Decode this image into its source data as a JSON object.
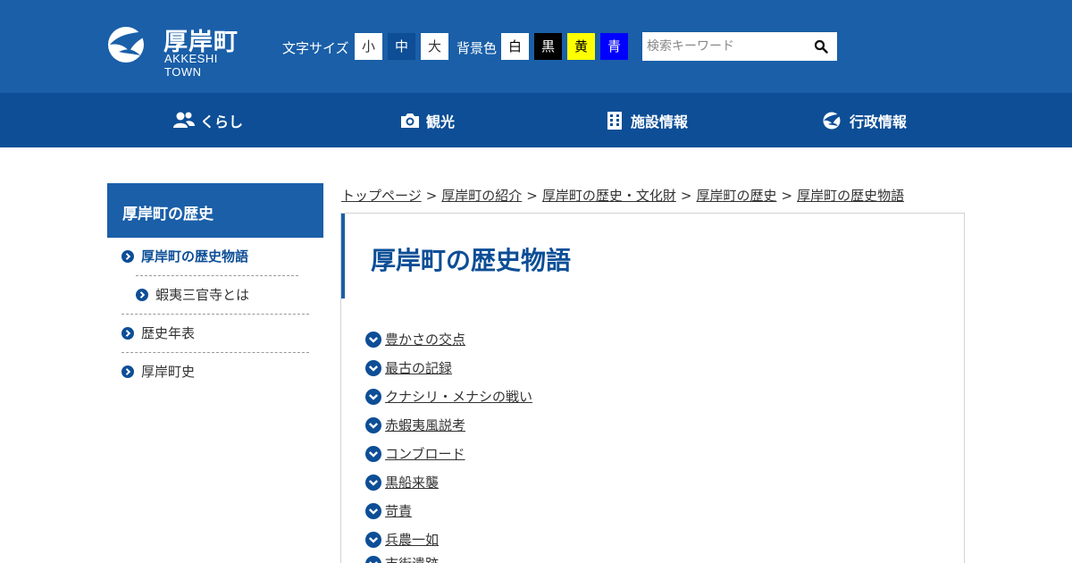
{
  "header": {
    "logo_jp": "厚岸町",
    "logo_en": "AKKESHI TOWN",
    "font_size_label": "文字サイズ",
    "font_sizes": [
      "小",
      "中",
      "大"
    ],
    "bg_color_label": "背景色",
    "bg_colors": [
      {
        "label": "白",
        "bg": "#ffffff",
        "fg": "#000000"
      },
      {
        "label": "黒",
        "bg": "#000000",
        "fg": "#ffffff"
      },
      {
        "label": "黄",
        "bg": "#ffff00",
        "fg": "#000000"
      },
      {
        "label": "青",
        "bg": "#0000ff",
        "fg": "#ffffff"
      }
    ],
    "search_placeholder": "検索キーワード"
  },
  "nav": [
    {
      "label": "くらし",
      "icon": "people-icon"
    },
    {
      "label": "観光",
      "icon": "camera-icon"
    },
    {
      "label": "施設情報",
      "icon": "building-icon"
    },
    {
      "label": "行政情報",
      "icon": "town-logo-icon"
    }
  ],
  "sidebar": {
    "heading": "厚岸町の歴史",
    "items": [
      {
        "label": "厚岸町の歴史物語",
        "active": true
      },
      {
        "label": "蝦夷三官寺とは",
        "active": false
      },
      {
        "label": "歴史年表",
        "active": false
      },
      {
        "label": "厚岸町史",
        "active": false
      }
    ]
  },
  "breadcrumb": [
    "トップページ",
    "厚岸町の紹介",
    "厚岸町の歴史・文化財",
    "厚岸町の歴史",
    "厚岸町の歴史物語"
  ],
  "breadcrumb_separator": ">",
  "main": {
    "title": "厚岸町の歴史物語",
    "toc": [
      "豊かさの交点",
      "最古の記録",
      "クナシリ・メナシの戦い",
      "赤蝦夷風説考",
      "コンブロード",
      "黒船来襲",
      "苛責",
      "兵農一如",
      "市街遺跡"
    ]
  },
  "colors": {
    "header_bg": "#1a5fa8",
    "nav_bg": "#0d4e96",
    "active_font_bg": "#0d4e96",
    "accent": "#0d4e96"
  }
}
